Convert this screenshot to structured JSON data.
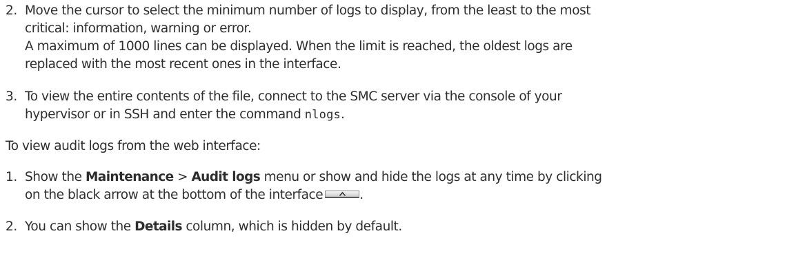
{
  "step2": {
    "number": "2.",
    "line1": "Move the cursor to select the minimum number of logs to display, from the least to the most",
    "line2": "critical: information, warning or error.",
    "line3": "A maximum of 1000 lines can be displayed. When the limit is reached, the oldest logs are",
    "line4": "replaced with the most recent ones in the interface."
  },
  "step3": {
    "number": "3.",
    "line1": "To view the entire contents of the file, connect to the SMC server via the console of your",
    "line2_prefix": "hypervisor or in SSH and enter the command ",
    "command": "nlogs",
    "line2_suffix": "."
  },
  "intro": "To view audit logs from the web interface:",
  "audit_step1": {
    "number": "1.",
    "show": "Show the ",
    "menu1": "Maintenance",
    "sep": " > ",
    "menu2": "Audit logs",
    "rest": " menu or show and hide the logs at any time by clicking",
    "line2": "on the black arrow at the bottom of the interface",
    "line2_end": ".",
    "arrow_icon": "caret-up-icon"
  },
  "audit_step2": {
    "number": "2.",
    "prefix": "You can show the ",
    "column": "Details",
    "suffix": " column, which is hidden by default."
  }
}
